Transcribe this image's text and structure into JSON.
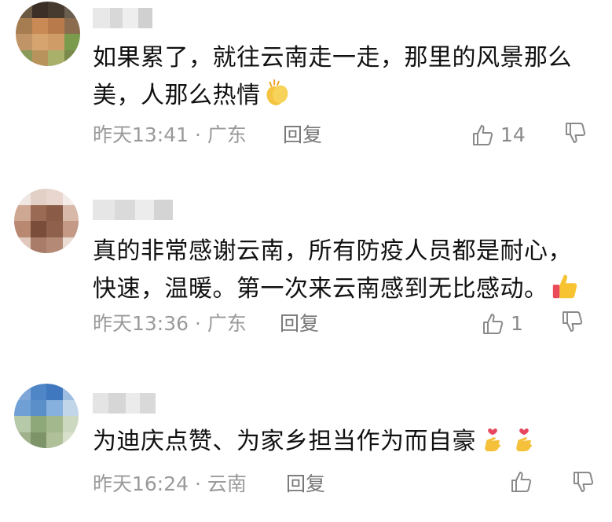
{
  "comments": [
    {
      "text_lines": [
        "如果累了，就往云南走一走，那里的风景那么",
        "美，人那么热情"
      ],
      "emoji": "clapping-hands-icon",
      "time": "昨天13:41",
      "separator": "·",
      "location": "广东",
      "reply_label": "回复",
      "like_count": "14"
    },
    {
      "text_lines": [
        "真的非常感谢云南，所有防疫人员都是耐心，",
        "快速，温暖。第一次来云南感到无比感动。"
      ],
      "emoji": "thumbs-up-icon",
      "time": "昨天13:36",
      "separator": "·",
      "location": "广东",
      "reply_label": "回复",
      "like_count": "1"
    },
    {
      "text_lines": [
        "为迪庆点赞、为家乡担当作为而自豪"
      ],
      "emoji": "finger-heart-icon",
      "time": "昨天16:24",
      "separator": "·",
      "location": "云南",
      "reply_label": "回复",
      "like_count": ""
    }
  ],
  "colors": {
    "text": "#111111",
    "meta": "#9a9a9a",
    "reply": "#777777"
  }
}
